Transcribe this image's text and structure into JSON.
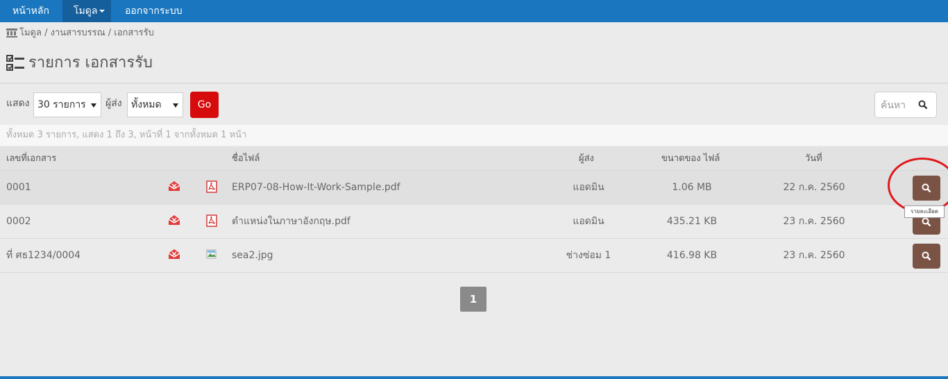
{
  "nav": {
    "home": "หน้าหลัก",
    "module": "โมดูล",
    "logout": "ออกจากระบบ"
  },
  "breadcrumb": "โมดูล / งานสารบรรณ / เอกสารรับ",
  "page_title": "รายการ เอกสารรับ",
  "filters": {
    "show_label": "แสดง",
    "show_value": "30 รายการ",
    "sender_label": "ผู้ส่ง",
    "sender_value": "ทั้งหมด",
    "go_label": "Go"
  },
  "search": {
    "placeholder": "ค้นหา"
  },
  "summary": "ทั้งหมด 3 รายการ, แสดง 1 ถึง 3, หน้าที่ 1 จากทั้งหมด 1 หน้า",
  "table": {
    "headers": {
      "doc_no": "เลขที่เอกสาร",
      "file_name": "ชื่อไฟล์",
      "sender": "ผู้ส่ง",
      "size": "ขนาดของ ไฟล์",
      "date": "วันที่"
    },
    "rows": [
      {
        "doc_no": "0001",
        "mail_icon": "mail-open-icon",
        "file_icon": "pdf-icon",
        "file_name": "ERP07-08-How-It-Work-Sample.pdf",
        "sender": "แอดมิน",
        "size": "1.06 MB",
        "date": "22 ก.ค. 2560"
      },
      {
        "doc_no": "0002",
        "mail_icon": "mail-open-icon",
        "file_icon": "pdf-icon",
        "file_name": "ตำแหน่งในภาษาอังกฤษ.pdf",
        "sender": "แอดมิน",
        "size": "435.21 KB",
        "date": "23 ก.ค. 2560"
      },
      {
        "doc_no": "ที่ ศธ1234/0004",
        "mail_icon": "mail-open-icon",
        "file_icon": "image-icon",
        "file_name": "sea2.jpg",
        "sender": "ช่างซ่อม 1",
        "size": "416.98 KB",
        "date": "23 ก.ค. 2560"
      }
    ]
  },
  "tooltip": "รายละเอียด",
  "pagination": {
    "current": "1"
  },
  "colors": {
    "navbar": "#1a77bf",
    "go_button": "#d60b0b",
    "view_button": "#7a5345",
    "annotation": "#e0181c"
  }
}
